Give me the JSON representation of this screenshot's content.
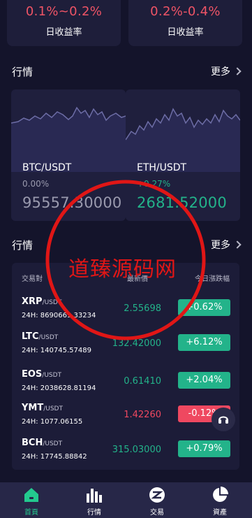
{
  "rates": [
    {
      "value": "0.1%~0.2%",
      "label": "日收益率"
    },
    {
      "value": "0.2%-0.4%",
      "label": "日收益率"
    }
  ],
  "section1": {
    "title": "行情",
    "more": "更多"
  },
  "section2": {
    "title": "行情",
    "more": "更多"
  },
  "market_cards": [
    {
      "pair": "BTC/USDT",
      "pct": "0.00%",
      "price": "95557.30000",
      "pct_color": "#9a9aae",
      "price_color": "#9a9aae"
    },
    {
      "pair": "ETH/USDT",
      "pct": "+0.27%",
      "price": "2681.52000",
      "pct_color": "#23b38a",
      "price_color": "#23b38a"
    }
  ],
  "list": {
    "headers": {
      "pair": "交易對",
      "price": "最新價",
      "change": "今日漲跌幅"
    },
    "rows": [
      {
        "base": "XRP",
        "quote": "/USDT",
        "volume": "24H: 8690669.33234",
        "price": "2.55698",
        "change": "+0.62%",
        "price_color": "#23b38a",
        "badge_color": "#23b38a"
      },
      {
        "base": "LTC",
        "quote": "/USDT",
        "volume": "24H: 140745.57489",
        "price": "132.42000",
        "change": "+6.12%",
        "price_color": "#23b38a",
        "badge_color": "#23b38a"
      },
      {
        "base": "EOS",
        "quote": "/USDT",
        "volume": "24H: 2038628.81194",
        "price": "0.61410",
        "change": "+2.04%",
        "price_color": "#23b38a",
        "badge_color": "#23b38a"
      },
      {
        "base": "YMT",
        "quote": "/USDT",
        "volume": "24H: 1077.06155",
        "price": "1.42260",
        "change": "-0.12%",
        "price_color": "#ef4860",
        "badge_color": "#ef4860"
      },
      {
        "base": "BCH",
        "quote": "/USDT",
        "volume": "24H: 17745.88842",
        "price": "315.03000",
        "change": "+0.79%",
        "price_color": "#23b38a",
        "badge_color": "#23b38a"
      }
    ]
  },
  "nav": [
    {
      "label": "首頁",
      "icon": "home-icon",
      "active": true
    },
    {
      "label": "行情",
      "icon": "bars-chart-icon",
      "active": false
    },
    {
      "label": "交易",
      "icon": "trade-icon",
      "active": false
    },
    {
      "label": "資產",
      "icon": "pie-chart-icon",
      "active": false
    }
  ],
  "watermark": {
    "title": "道臻源码网"
  },
  "colors": {
    "up": "#23b38a",
    "down": "#ef4860",
    "accent": "#ef5466",
    "nav_active": "#23c98e"
  }
}
